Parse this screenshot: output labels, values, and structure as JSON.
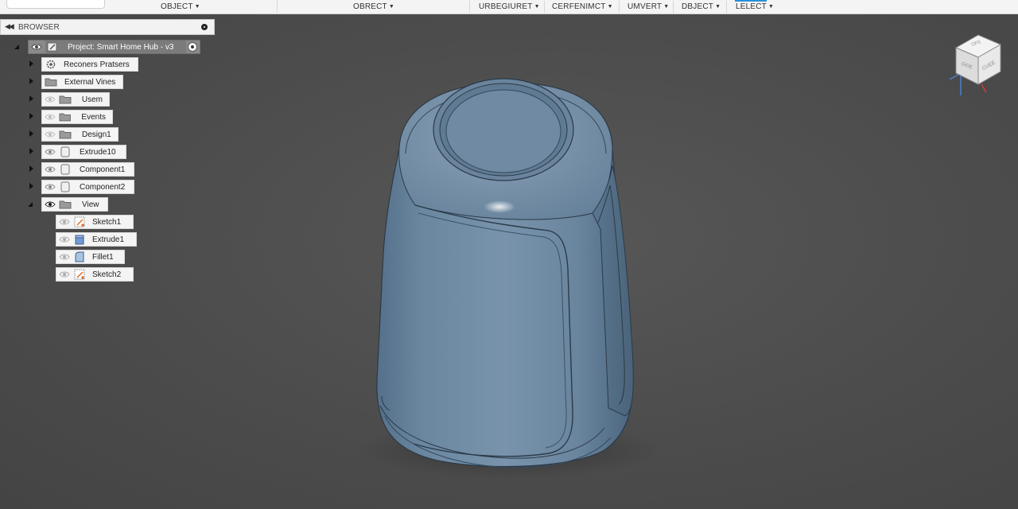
{
  "toolbar": {
    "menus": [
      {
        "label": "OBJECT"
      },
      {
        "label": "OBRECT"
      },
      {
        "label": "URBEGIURET"
      },
      {
        "label": "CERFENIMCT"
      },
      {
        "label": "UMVERT"
      },
      {
        "label": "DBJECT"
      },
      {
        "label": "LELECT"
      }
    ]
  },
  "browser": {
    "title": "BROWSER",
    "root": {
      "label": "Project: Smart Home Hub - v3"
    },
    "items": [
      {
        "label": "Reconers Pratsers"
      },
      {
        "label": "External Vines"
      },
      {
        "label": "Usem"
      },
      {
        "label": "Events"
      },
      {
        "label": "Design1"
      },
      {
        "label": "Extrude10"
      },
      {
        "label": "Component1"
      },
      {
        "label": "Component2"
      },
      {
        "label": "View"
      }
    ],
    "children": [
      {
        "label": "Sketch1"
      },
      {
        "label": "Extrude1"
      },
      {
        "label": "Fillet1"
      },
      {
        "label": "Sketch2"
      }
    ]
  },
  "viewcube": {
    "faces": [
      {
        "label": "GIDE"
      },
      {
        "label": "CUEE"
      },
      {
        "label": "OPE"
      }
    ]
  },
  "colors": {
    "viewport_bg": "#4c4c4c",
    "model_body": "#6d8aa3",
    "accent_blue": "#2a8fd8"
  }
}
